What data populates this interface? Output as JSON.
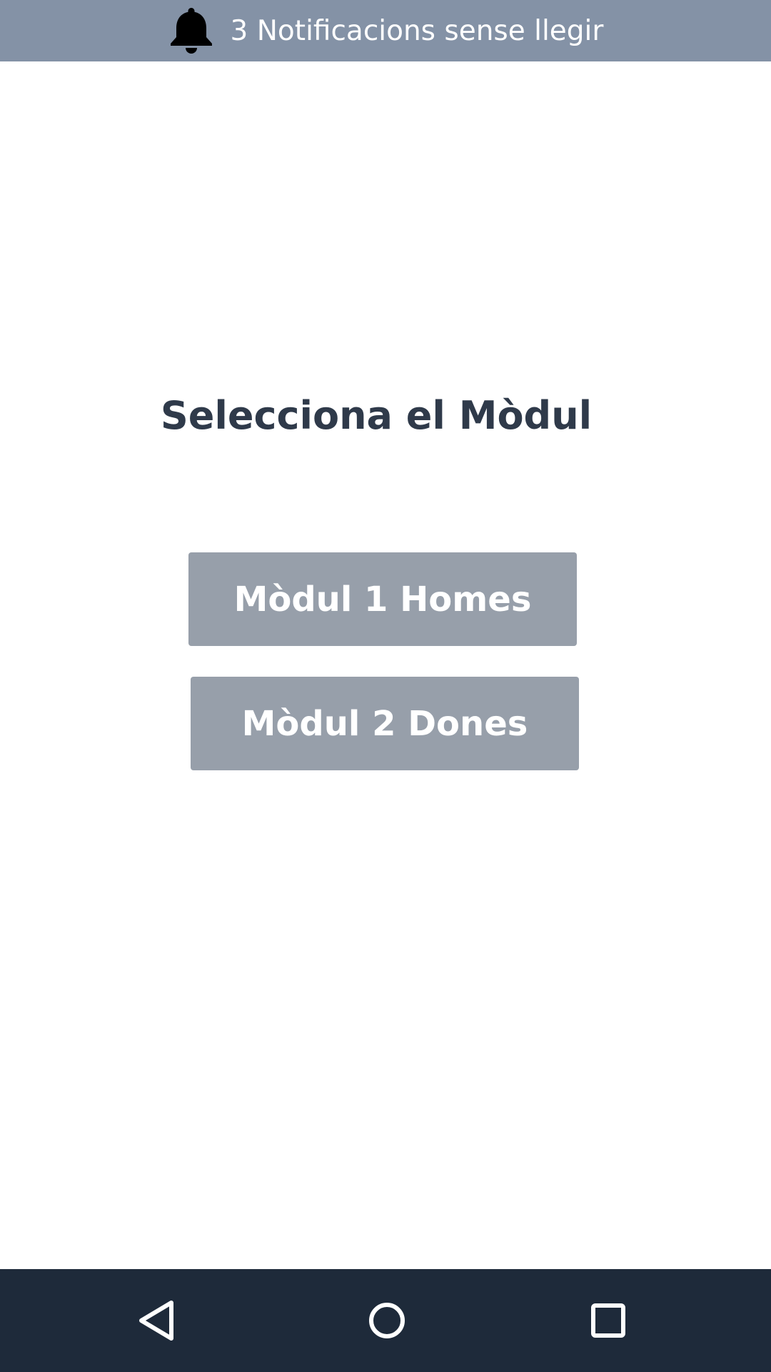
{
  "notification_bar": {
    "icon": "bell-icon",
    "text": "3 Notificacions sense llegir",
    "background": "#8492a6"
  },
  "main": {
    "title": "Selecciona el Mòdul",
    "buttons": [
      {
        "label": "Mòdul 1 Homes"
      },
      {
        "label": "Mòdul 2 Dones"
      }
    ],
    "button_color": "#979faa"
  },
  "system_nav": {
    "background": "#1e2a3a",
    "buttons": [
      {
        "icon": "back-triangle-icon"
      },
      {
        "icon": "home-circle-icon"
      },
      {
        "icon": "recents-square-icon"
      }
    ]
  }
}
